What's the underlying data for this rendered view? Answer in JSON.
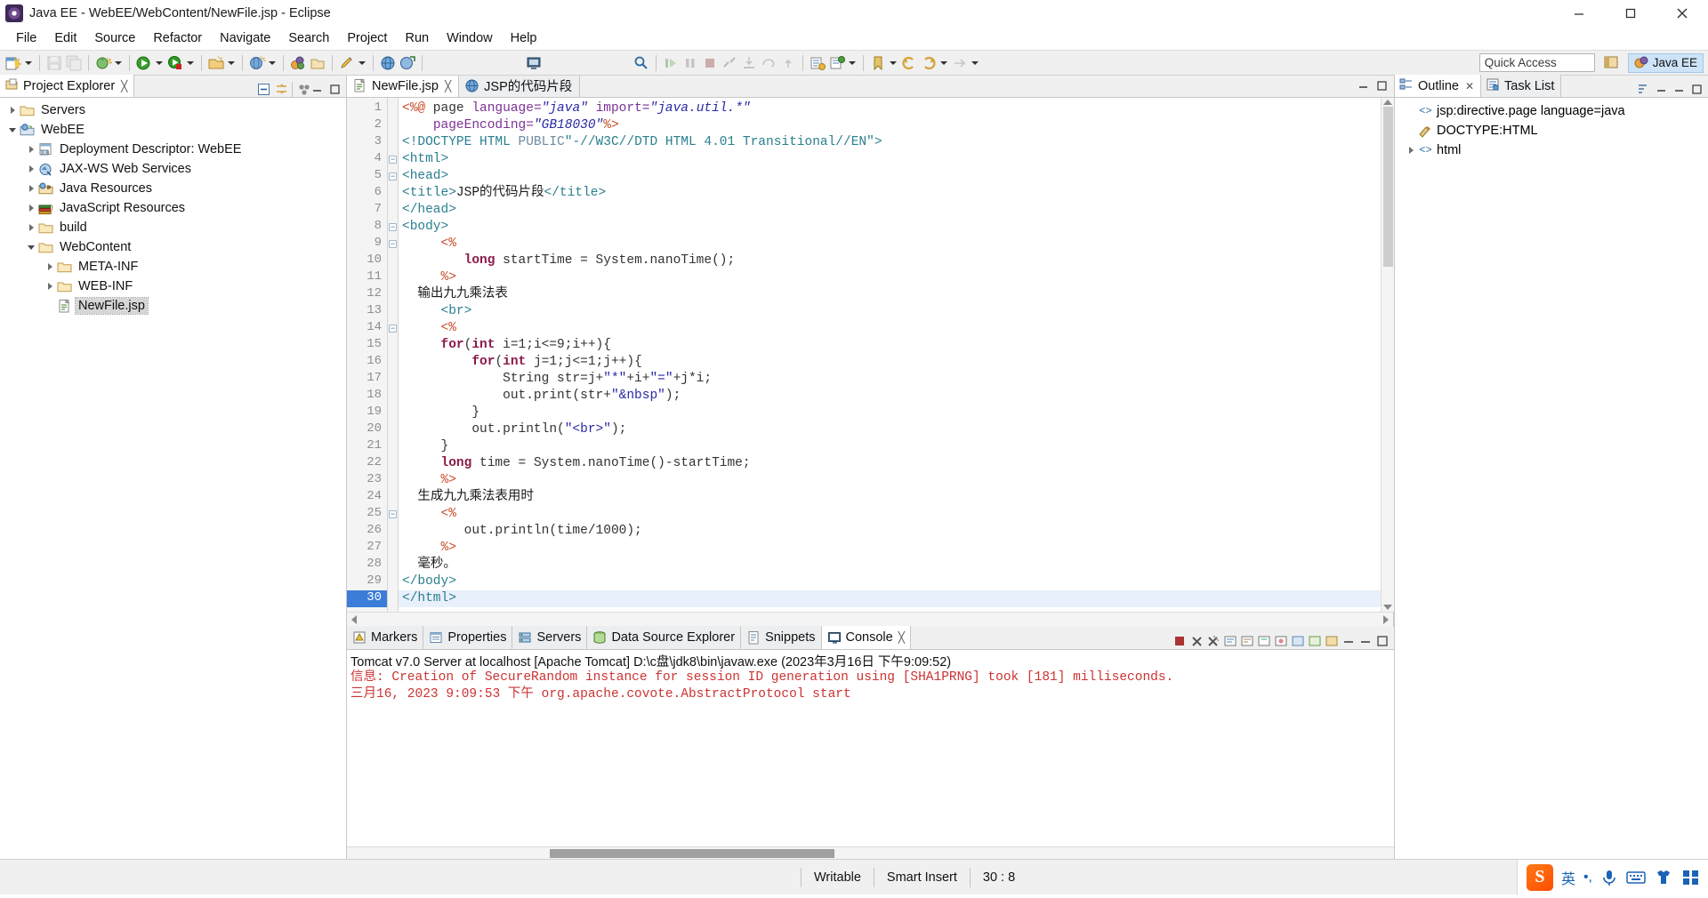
{
  "window": {
    "title": "Java EE - WebEE/WebContent/NewFile.jsp - Eclipse",
    "app_icon": "eclipse-icon",
    "minimize": "minimize-icon",
    "maximize": "maximize-icon",
    "close": "close-icon"
  },
  "menu": [
    "File",
    "Edit",
    "Source",
    "Refactor",
    "Navigate",
    "Search",
    "Project",
    "Run",
    "Window",
    "Help"
  ],
  "toolbar": {
    "quick_access_placeholder": "Quick Access",
    "perspective_other": "",
    "perspective_active": "Java EE"
  },
  "project_explorer": {
    "tab_label": "Project Explorer",
    "close_glyph": "╳",
    "tree": [
      {
        "label": "Servers",
        "depth": 0,
        "twist": "closed",
        "icon": "folder-icon",
        "selected": false
      },
      {
        "label": "WebEE",
        "depth": 0,
        "twist": "open",
        "icon": "web-project-icon",
        "selected": false
      },
      {
        "label": "Deployment Descriptor: WebEE",
        "depth": 1,
        "twist": "closed",
        "icon": "deployment-descriptor-icon",
        "selected": false
      },
      {
        "label": "JAX-WS Web Services",
        "depth": 1,
        "twist": "closed",
        "icon": "jaxws-icon",
        "selected": false
      },
      {
        "label": "Java Resources",
        "depth": 1,
        "twist": "closed",
        "icon": "java-resources-icon",
        "selected": false
      },
      {
        "label": "JavaScript Resources",
        "depth": 1,
        "twist": "closed",
        "icon": "javascript-resources-icon",
        "selected": false
      },
      {
        "label": "build",
        "depth": 1,
        "twist": "closed",
        "icon": "folder-icon",
        "selected": false
      },
      {
        "label": "WebContent",
        "depth": 1,
        "twist": "open",
        "icon": "folder-icon",
        "selected": false
      },
      {
        "label": "META-INF",
        "depth": 2,
        "twist": "closed",
        "icon": "folder-icon",
        "selected": false
      },
      {
        "label": "WEB-INF",
        "depth": 2,
        "twist": "closed",
        "icon": "folder-icon",
        "selected": false
      },
      {
        "label": "NewFile.jsp",
        "depth": 2,
        "twist": "none",
        "icon": "jsp-file-icon",
        "selected": true
      }
    ]
  },
  "editor": {
    "tabs": [
      {
        "label": "NewFile.jsp",
        "icon": "jsp-file-icon",
        "active": true,
        "closable": true
      },
      {
        "label": "JSP的代码片段",
        "icon": "browser-icon",
        "active": false,
        "closable": false
      }
    ],
    "current_line": 30,
    "lines": [
      {
        "n": 1,
        "fold": false,
        "cur": false,
        "segs": [
          {
            "t": "<%@",
            "c": "k-jsp"
          },
          {
            "t": " page ",
            "c": "k-plain"
          },
          {
            "t": "language=",
            "c": "k-attr"
          },
          {
            "t": "\"java\"",
            "c": "k-str"
          },
          {
            "t": " ",
            "c": "k-plain"
          },
          {
            "t": "import=",
            "c": "k-attr"
          },
          {
            "t": "\"java.util.*\"",
            "c": "k-str"
          }
        ]
      },
      {
        "n": 2,
        "fold": false,
        "cur": false,
        "segs": [
          {
            "t": "    ",
            "c": "k-plain"
          },
          {
            "t": "pageEncoding=",
            "c": "k-attr"
          },
          {
            "t": "\"GB18030\"",
            "c": "k-str"
          },
          {
            "t": "%>",
            "c": "k-jsp"
          }
        ]
      },
      {
        "n": 3,
        "fold": false,
        "cur": false,
        "segs": [
          {
            "t": "<!DOCTYPE HTML ",
            "c": "k-tag"
          },
          {
            "t": "PUBLIC",
            "c": "k-doct"
          },
          {
            "t": "\"-//W3C//DTD HTML 4.01 Transitional//EN\"",
            "c": "k-tag"
          },
          {
            "t": ">",
            "c": "k-tag"
          }
        ]
      },
      {
        "n": 4,
        "fold": true,
        "cur": false,
        "segs": [
          {
            "t": "<html>",
            "c": "k-tag"
          }
        ]
      },
      {
        "n": 5,
        "fold": true,
        "cur": false,
        "segs": [
          {
            "t": "<head>",
            "c": "k-tag"
          }
        ]
      },
      {
        "n": 6,
        "fold": false,
        "cur": false,
        "segs": [
          {
            "t": "<title>",
            "c": "k-tag"
          },
          {
            "t": "JSP的代码片段",
            "c": "k-txt"
          },
          {
            "t": "</title>",
            "c": "k-tag"
          }
        ]
      },
      {
        "n": 7,
        "fold": false,
        "cur": false,
        "segs": [
          {
            "t": "</head>",
            "c": "k-tag"
          }
        ]
      },
      {
        "n": 8,
        "fold": true,
        "cur": false,
        "segs": [
          {
            "t": "<body>",
            "c": "k-tag"
          }
        ]
      },
      {
        "n": 9,
        "fold": true,
        "cur": false,
        "segs": [
          {
            "t": "     ",
            "c": "k-plain"
          },
          {
            "t": "<%",
            "c": "k-jsp"
          }
        ]
      },
      {
        "n": 10,
        "fold": false,
        "cur": false,
        "segs": [
          {
            "t": "        ",
            "c": "k-plain"
          },
          {
            "t": "long",
            "c": "k-kw"
          },
          {
            "t": " startTime = System.nanoTime();",
            "c": "k-plain"
          }
        ]
      },
      {
        "n": 11,
        "fold": false,
        "cur": false,
        "segs": [
          {
            "t": "     ",
            "c": "k-plain"
          },
          {
            "t": "%>",
            "c": "k-jsp"
          }
        ]
      },
      {
        "n": 12,
        "fold": false,
        "cur": false,
        "segs": [
          {
            "t": "  输出九九乘法表",
            "c": "k-txt"
          }
        ]
      },
      {
        "n": 13,
        "fold": false,
        "cur": false,
        "segs": [
          {
            "t": "     ",
            "c": "k-plain"
          },
          {
            "t": "<br>",
            "c": "k-tag"
          }
        ]
      },
      {
        "n": 14,
        "fold": true,
        "cur": false,
        "segs": [
          {
            "t": "     ",
            "c": "k-plain"
          },
          {
            "t": "<%",
            "c": "k-jsp"
          }
        ]
      },
      {
        "n": 15,
        "fold": false,
        "cur": false,
        "segs": [
          {
            "t": "     ",
            "c": "k-plain"
          },
          {
            "t": "for",
            "c": "k-kw"
          },
          {
            "t": "(",
            "c": "k-plain"
          },
          {
            "t": "int",
            "c": "k-kw"
          },
          {
            "t": " i=1;i<=9;i++){",
            "c": "k-plain"
          }
        ]
      },
      {
        "n": 16,
        "fold": false,
        "cur": false,
        "segs": [
          {
            "t": "         ",
            "c": "k-plain"
          },
          {
            "t": "for",
            "c": "k-kw"
          },
          {
            "t": "(",
            "c": "k-plain"
          },
          {
            "t": "int",
            "c": "k-kw"
          },
          {
            "t": " j=1;j<=1;j++){",
            "c": "k-plain"
          }
        ]
      },
      {
        "n": 17,
        "fold": false,
        "cur": false,
        "segs": [
          {
            "t": "             String str=j+",
            "c": "k-plain"
          },
          {
            "t": "\"*\"",
            "c": "k-str2"
          },
          {
            "t": "+i+",
            "c": "k-plain"
          },
          {
            "t": "\"=\"",
            "c": "k-str2"
          },
          {
            "t": "+j*i;",
            "c": "k-plain"
          }
        ]
      },
      {
        "n": 18,
        "fold": false,
        "cur": false,
        "segs": [
          {
            "t": "             out.print(str+",
            "c": "k-plain"
          },
          {
            "t": "\"&nbsp\"",
            "c": "k-str2"
          },
          {
            "t": ");",
            "c": "k-plain"
          }
        ]
      },
      {
        "n": 19,
        "fold": false,
        "cur": false,
        "segs": [
          {
            "t": "         }",
            "c": "k-plain"
          }
        ]
      },
      {
        "n": 20,
        "fold": false,
        "cur": false,
        "segs": [
          {
            "t": "         out.println(",
            "c": "k-plain"
          },
          {
            "t": "\"<br>\"",
            "c": "k-str2"
          },
          {
            "t": ");",
            "c": "k-plain"
          }
        ]
      },
      {
        "n": 21,
        "fold": false,
        "cur": false,
        "segs": [
          {
            "t": "     }",
            "c": "k-plain"
          }
        ]
      },
      {
        "n": 22,
        "fold": false,
        "cur": false,
        "segs": [
          {
            "t": "     ",
            "c": "k-plain"
          },
          {
            "t": "long",
            "c": "k-kw"
          },
          {
            "t": " time = System.nanoTime()-startTime;",
            "c": "k-plain"
          }
        ]
      },
      {
        "n": 23,
        "fold": false,
        "cur": false,
        "segs": [
          {
            "t": "     ",
            "c": "k-plain"
          },
          {
            "t": "%>",
            "c": "k-jsp"
          }
        ]
      },
      {
        "n": 24,
        "fold": false,
        "cur": false,
        "segs": [
          {
            "t": "  生成九九乘法表用时",
            "c": "k-txt"
          }
        ]
      },
      {
        "n": 25,
        "fold": true,
        "cur": false,
        "segs": [
          {
            "t": "     ",
            "c": "k-plain"
          },
          {
            "t": "<%",
            "c": "k-jsp"
          }
        ]
      },
      {
        "n": 26,
        "fold": false,
        "cur": false,
        "segs": [
          {
            "t": "        out.println(time/1000);",
            "c": "k-plain"
          }
        ]
      },
      {
        "n": 27,
        "fold": false,
        "cur": false,
        "segs": [
          {
            "t": "     ",
            "c": "k-plain"
          },
          {
            "t": "%>",
            "c": "k-jsp"
          }
        ]
      },
      {
        "n": 28,
        "fold": false,
        "cur": false,
        "segs": [
          {
            "t": "  毫秒。",
            "c": "k-txt"
          }
        ]
      },
      {
        "n": 29,
        "fold": false,
        "cur": false,
        "segs": [
          {
            "t": "</body>",
            "c": "k-tag"
          }
        ]
      },
      {
        "n": 30,
        "fold": false,
        "cur": true,
        "segs": [
          {
            "t": "</html>",
            "c": "k-tag"
          }
        ]
      }
    ]
  },
  "outline": {
    "tabs": [
      {
        "label": "Outline",
        "icon": "outline-icon",
        "active": true,
        "closable": true
      },
      {
        "label": "Task List",
        "icon": "tasklist-icon",
        "active": false,
        "closable": false
      }
    ],
    "items": [
      {
        "label": "jsp:directive.page language=java",
        "icon": "element-icon",
        "twist": "none",
        "depth": 0
      },
      {
        "label": "DOCTYPE:HTML",
        "icon": "doctype-icon",
        "twist": "none",
        "depth": 0
      },
      {
        "label": "html",
        "icon": "element-icon",
        "twist": "closed",
        "depth": 0
      }
    ]
  },
  "bottom_panel": {
    "tabs": [
      {
        "label": "Markers",
        "icon": "markers-icon",
        "active": false,
        "closable": false
      },
      {
        "label": "Properties",
        "icon": "properties-icon",
        "active": false,
        "closable": false
      },
      {
        "label": "Servers",
        "icon": "servers-icon",
        "active": false,
        "closable": false
      },
      {
        "label": "Data Source Explorer",
        "icon": "datasource-icon",
        "active": false,
        "closable": false
      },
      {
        "label": "Snippets",
        "icon": "snippets-icon",
        "active": false,
        "closable": false
      },
      {
        "label": "Console",
        "icon": "console-icon",
        "active": true,
        "closable": true
      }
    ],
    "console_header": "Tomcat v7.0 Server at localhost [Apache Tomcat] D:\\c盘\\jdk8\\bin\\javaw.exe (2023年3月16日 下午9:09:52)",
    "console_lines": [
      "信息: Creation of SecureRandom instance for session ID generation using [SHA1PRNG] took [181] milliseconds.",
      "三月16, 2023 9:09:53 下午 org.apache.covote.AbstractProtocol start"
    ]
  },
  "statusbar": {
    "writable": "Writable",
    "insert_mode": "Smart Insert",
    "position": "30 : 8",
    "ime": {
      "logo": "sogou-logo",
      "lang": "英",
      "punct": "•,",
      "mic": "mic-icon",
      "keyboard": "keyboard-icon",
      "shirt": "skin-icon",
      "apps": "apps-icon"
    }
  }
}
